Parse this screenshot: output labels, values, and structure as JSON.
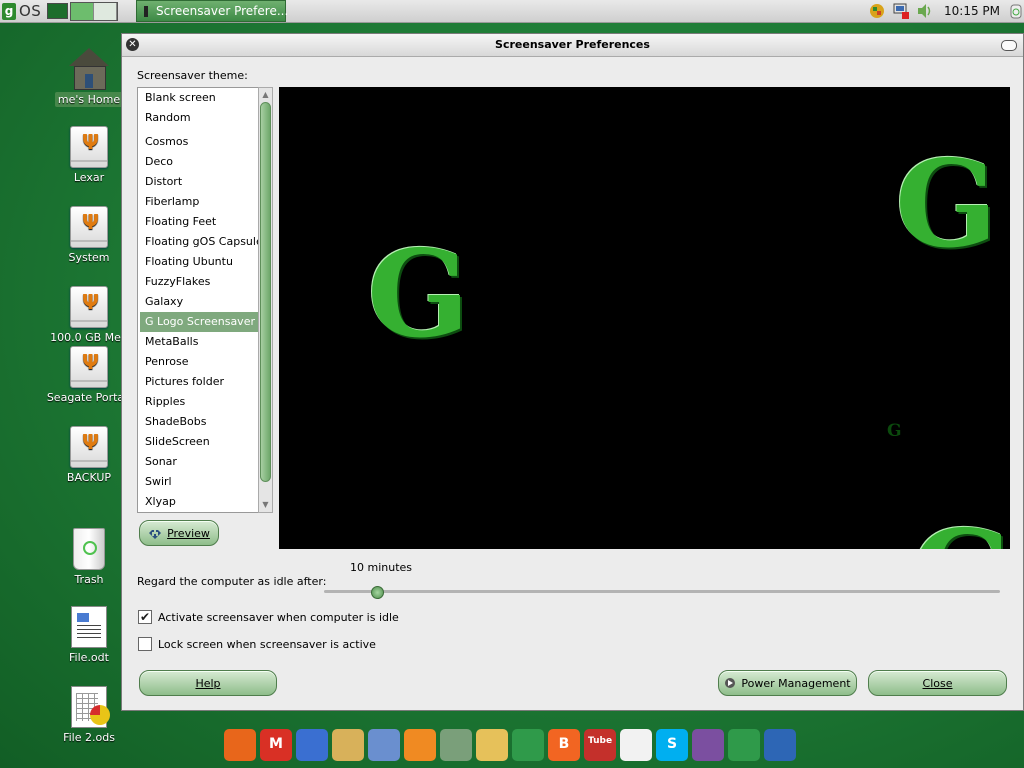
{
  "top_panel": {
    "logo_letter": "g",
    "logo_text": "OS",
    "taskbar_window_title": "Screensaver Prefere...",
    "clock": "10:15 PM"
  },
  "desktop": {
    "icons": [
      {
        "label": "me's Home",
        "icon": "home-icon"
      },
      {
        "label": "Lexar",
        "icon": "usb-drive-icon"
      },
      {
        "label": "System",
        "icon": "usb-drive-icon"
      },
      {
        "label": "100.0 GB Med",
        "icon": "usb-drive-icon"
      },
      {
        "label": "Seagate Portab",
        "icon": "usb-drive-icon"
      },
      {
        "label": "BACKUP",
        "icon": "usb-drive-icon"
      },
      {
        "label": "Trash",
        "icon": "trash-icon"
      },
      {
        "label": "File.odt",
        "icon": "document-icon"
      },
      {
        "label": "File 2.ods",
        "icon": "spreadsheet-icon"
      }
    ]
  },
  "window": {
    "title": "Screensaver Preferences",
    "theme_label": "Screensaver theme:",
    "themes": [
      "Blank screen",
      "Random",
      "Cosmos",
      "Deco",
      "Distort",
      "Fiberlamp",
      "Floating Feet",
      "Floating gOS Capsule",
      "Floating Ubuntu",
      "FuzzyFlakes",
      "Galaxy",
      "G Logo Screensaver",
      "MetaBalls",
      "Penrose",
      "Pictures folder",
      "Ripples",
      "ShadeBobs",
      "SlideScreen",
      "Sonar",
      "Swirl",
      "Xlyap"
    ],
    "selected_theme": "G Logo Screensaver",
    "preview_button": "Preview",
    "preview_logo_letter": "G",
    "idle_label": "Regard the computer as idle after:",
    "idle_value": "10 minutes",
    "idle_slider_fraction": 0.078,
    "activate_label": "Activate screensaver when computer is idle",
    "activate_checked": true,
    "lock_label": "Lock screen when screensaver is active",
    "lock_checked": false,
    "help_button": "Help",
    "power_button": "Power Management",
    "close_button": "Close"
  },
  "dock": [
    {
      "name": "firefox-icon",
      "color": "#e8661b",
      "glyph": ""
    },
    {
      "name": "gmail-icon",
      "color": "#d93025",
      "glyph": "M"
    },
    {
      "name": "calendar-icon",
      "color": "#3a6fd1",
      "glyph": ""
    },
    {
      "name": "editor-icon",
      "color": "#d8b15a",
      "glyph": ""
    },
    {
      "name": "tools-icon",
      "color": "#6a8fcf",
      "glyph": ""
    },
    {
      "name": "rss-icon",
      "color": "#f08a22",
      "glyph": ""
    },
    {
      "name": "news-icon",
      "color": "#7a9f7a",
      "glyph": ""
    },
    {
      "name": "shopping-bag-icon",
      "color": "#e6c15a",
      "glyph": ""
    },
    {
      "name": "chart-icon",
      "color": "#2f9a4a",
      "glyph": ""
    },
    {
      "name": "blogger-icon",
      "color": "#f26522",
      "glyph": "B"
    },
    {
      "name": "youtube-icon",
      "color": "#c4302b",
      "glyph": "Tube"
    },
    {
      "name": "chat-icon",
      "color": "#f2f2f2",
      "glyph": ""
    },
    {
      "name": "skype-icon",
      "color": "#00aff0",
      "glyph": "S"
    },
    {
      "name": "openoffice-purple-icon",
      "color": "#7b4fa0",
      "glyph": ""
    },
    {
      "name": "openoffice-green-icon",
      "color": "#2f9a4a",
      "glyph": ""
    },
    {
      "name": "openoffice-blue-icon",
      "color": "#2d66b5",
      "glyph": ""
    }
  ]
}
